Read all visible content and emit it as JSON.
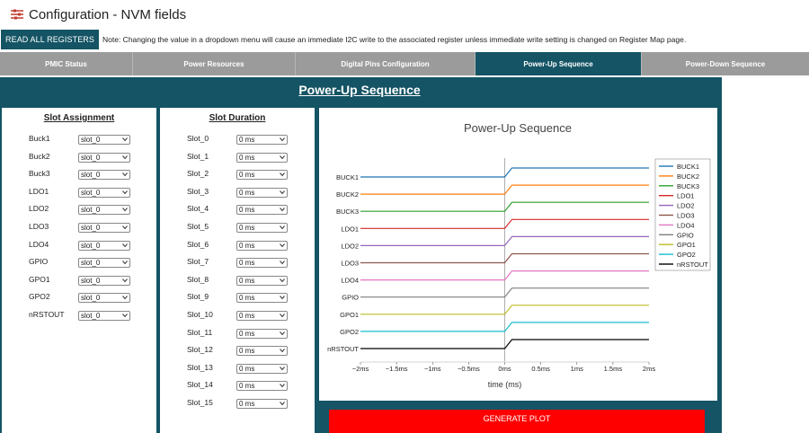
{
  "title": "Configuration - NVM fields",
  "read_all_label": "READ ALL REGISTERS",
  "note": "Note: Changing the value in a dropdown menu will cause an immediate I2C write to the associated register unless immediate write setting is changed on Register Map page.",
  "tabs": [
    {
      "label": "PMIC Status",
      "active": false
    },
    {
      "label": "Power Resources",
      "active": false
    },
    {
      "label": "Digital Pins Configuration",
      "active": false
    },
    {
      "label": "Power-Up Sequence",
      "active": true
    },
    {
      "label": "Power-Down Sequence",
      "active": false
    }
  ],
  "panel_title": "Power-Up Sequence",
  "slot_assignment": {
    "title": "Slot Assignment",
    "rows": [
      {
        "label": "Buck1",
        "value": "slot_0"
      },
      {
        "label": "Buck2",
        "value": "slot_0"
      },
      {
        "label": "Buck3",
        "value": "slot_0"
      },
      {
        "label": "LDO1",
        "value": "slot_0"
      },
      {
        "label": "LDO2",
        "value": "slot_0"
      },
      {
        "label": "LDO3",
        "value": "slot_0"
      },
      {
        "label": "LDO4",
        "value": "slot_0"
      },
      {
        "label": "GPIO",
        "value": "slot_0"
      },
      {
        "label": "GPO1",
        "value": "slot_0"
      },
      {
        "label": "GPO2",
        "value": "slot_0"
      },
      {
        "label": "nRSTOUT",
        "value": "slot_0"
      }
    ]
  },
  "slot_duration": {
    "title": "Slot Duration",
    "rows": [
      {
        "label": "Slot_0",
        "value": "0 ms"
      },
      {
        "label": "Slot_1",
        "value": "0 ms"
      },
      {
        "label": "Slot_2",
        "value": "0 ms"
      },
      {
        "label": "Slot_3",
        "value": "0 ms"
      },
      {
        "label": "Slot_4",
        "value": "0 ms"
      },
      {
        "label": "Slot_5",
        "value": "0 ms"
      },
      {
        "label": "Slot_6",
        "value": "0 ms"
      },
      {
        "label": "Slot_7",
        "value": "0 ms"
      },
      {
        "label": "Slot_8",
        "value": "0 ms"
      },
      {
        "label": "Slot_9",
        "value": "0 ms"
      },
      {
        "label": "Slot_10",
        "value": "0 ms"
      },
      {
        "label": "Slot_11",
        "value": "0 ms"
      },
      {
        "label": "Slot_12",
        "value": "0 ms"
      },
      {
        "label": "Slot_13",
        "value": "0 ms"
      },
      {
        "label": "Slot_14",
        "value": "0 ms"
      },
      {
        "label": "Slot_15",
        "value": "0 ms"
      }
    ]
  },
  "generate_label": "GENERATE PLOT",
  "colors": {
    "teal": "#145464",
    "tab_gray": "#9b9b9b",
    "generate_red": "#ff0000"
  },
  "icons": {
    "title": "sliders-icon",
    "dropdown": "chevron-down-icon"
  },
  "chart_data": {
    "type": "line",
    "title": "Power-Up Sequence",
    "xlabel": "time (ms)",
    "ylabel": "",
    "xlim": [
      -2,
      2
    ],
    "x_ticks": [
      -2,
      -1.5,
      -1,
      -0.5,
      0,
      0.5,
      1,
      1.5,
      2
    ],
    "x_tick_labels": [
      "−2ms",
      "−1.5ms",
      "−1ms",
      "−0.5ms",
      "0ms",
      "0.5ms",
      "1ms",
      "1.5ms",
      "2ms"
    ],
    "step_time": 0,
    "ramp_end": 0.1,
    "grid": false,
    "legend_position": "right",
    "series": [
      {
        "name": "BUCK1",
        "color": "#1f77b4"
      },
      {
        "name": "BUCK2",
        "color": "#ff7f0e"
      },
      {
        "name": "BUCK3",
        "color": "#2ca02c"
      },
      {
        "name": "LDO1",
        "color": "#d62728"
      },
      {
        "name": "LDO2",
        "color": "#9467bd"
      },
      {
        "name": "LDO3",
        "color": "#8c564b"
      },
      {
        "name": "LDO4",
        "color": "#e377c2"
      },
      {
        "name": "GPIO",
        "color": "#7f7f7f"
      },
      {
        "name": "GPO1",
        "color": "#bcbd22"
      },
      {
        "name": "GPO2",
        "color": "#17becf"
      },
      {
        "name": "nRSTOUT",
        "color": "#000000"
      }
    ],
    "y_labels": [
      "BUCK1",
      "BUCK2",
      "BUCK3",
      "LDO1",
      "LDO2",
      "LDO3",
      "LDO4",
      "GPIO",
      "GPO1",
      "GPO2",
      "nRSTOUT"
    ]
  }
}
